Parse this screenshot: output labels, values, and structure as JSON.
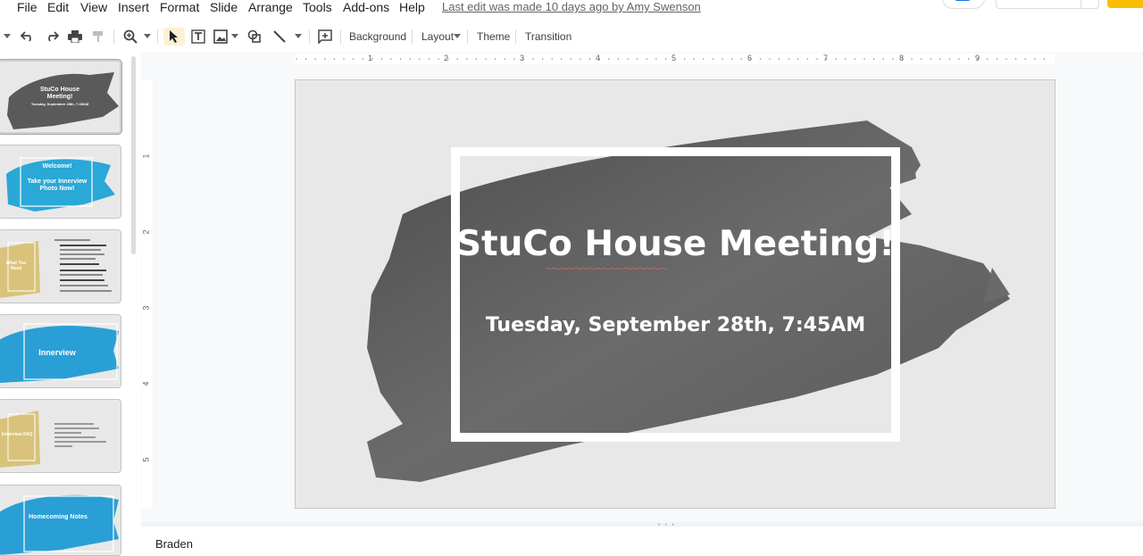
{
  "menubar": {
    "items": [
      "File",
      "Edit",
      "View",
      "Insert",
      "Format",
      "Slide",
      "Arrange",
      "Tools",
      "Add-ons",
      "Help"
    ],
    "last_edit": "Last edit was made 10 days ago by Amy Swenson"
  },
  "toolbar": {
    "background_label": "Background",
    "layout_label": "Layout",
    "theme_label": "Theme",
    "transition_label": "Transition",
    "icons": [
      "undo-icon",
      "redo-icon",
      "print-icon",
      "paint-format-icon",
      "zoom-icon",
      "select-icon",
      "text-box-icon",
      "image-icon",
      "shape-icon",
      "line-icon",
      "comment-icon"
    ]
  },
  "filmstrip": {
    "slides": [
      {
        "title": "StuCo House Meeting!",
        "subtitle": "Tuesday, September 28th, 7:45AM",
        "color": "#5a5a5a"
      },
      {
        "title": "Welcome!",
        "subtitle": "Take your Innerview Photo Now!",
        "color": "#2aa8d8"
      },
      {
        "title": "What You Need",
        "subtitle": "",
        "color": "#d9c27a"
      },
      {
        "title": "Innerview",
        "subtitle": "",
        "color": "#2a9fd6"
      },
      {
        "title": "Innerview FAQ",
        "subtitle": "",
        "color": "#d9c27a"
      },
      {
        "title": "Homecoming Notes",
        "subtitle": "",
        "color": "#2a9fd6"
      }
    ]
  },
  "rulers": {
    "horizontal": [
      "1",
      "2",
      "3",
      "4",
      "5",
      "6",
      "7",
      "8",
      "9"
    ],
    "vertical": [
      "1",
      "2",
      "3",
      "4",
      "5"
    ]
  },
  "slide": {
    "title": "StuCo House Meeting!",
    "subtitle": "Tuesday, September 28th, 7:45AM"
  },
  "notes": {
    "text": "Braden"
  },
  "colors": {
    "accent": "#1a73e8",
    "share": "#fbbc04",
    "brush": "#595959"
  }
}
